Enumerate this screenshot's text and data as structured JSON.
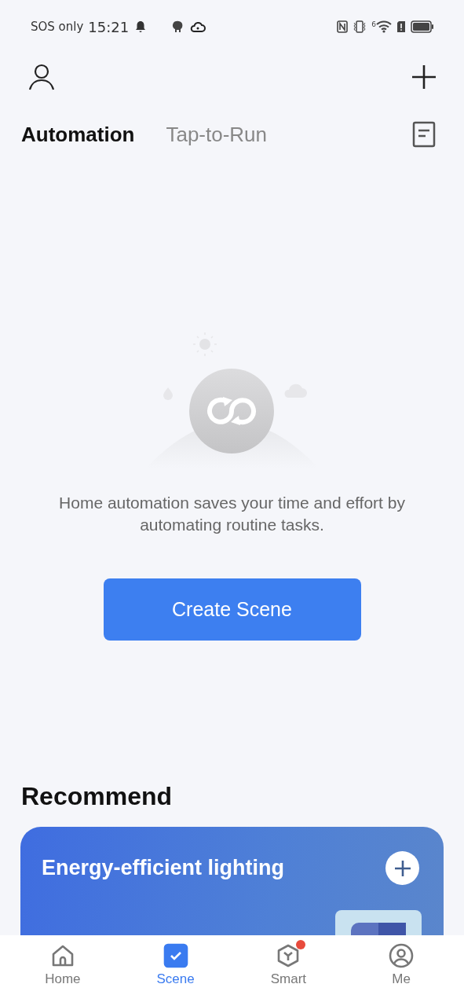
{
  "status_bar": {
    "carrier": "SOS only",
    "time": "15:21",
    "wifi_label": "6"
  },
  "tabs": [
    {
      "label": "Automation",
      "selected": true
    },
    {
      "label": "Tap-to-Run",
      "selected": false
    }
  ],
  "empty_state": {
    "message": "Home automation saves your time and effort by automating routine tasks.",
    "button": "Create Scene"
  },
  "recommend": {
    "title": "Recommend",
    "cards": [
      {
        "title": "Energy-efficient lighting"
      }
    ]
  },
  "nav": [
    {
      "kind": "home",
      "label": "Home",
      "selected": false,
      "badge": false
    },
    {
      "kind": "scene",
      "label": "Scene",
      "selected": true,
      "badge": false
    },
    {
      "kind": "smart",
      "label": "Smart",
      "selected": false,
      "badge": true
    },
    {
      "kind": "me",
      "label": "Me",
      "selected": false,
      "badge": false
    }
  ]
}
